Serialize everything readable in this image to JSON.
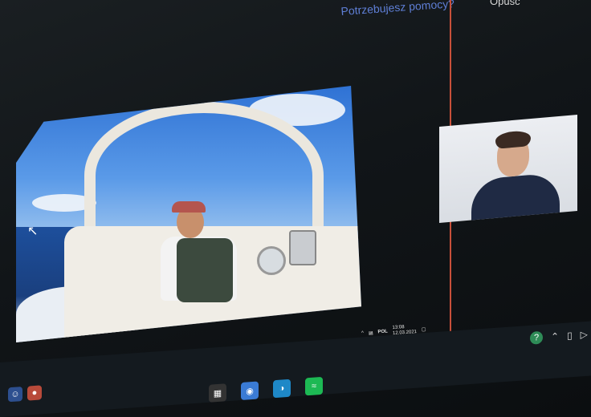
{
  "header": {
    "help_link": "Potrzebujesz pomocy?",
    "top_right_label": "Opuść"
  },
  "tray": {
    "language": "POL",
    "time": "13:08",
    "date": "12.03.2021"
  },
  "icons": {
    "cursor": "mouse-pointer-icon",
    "help": "help-icon",
    "chevron": "chevron-up-icon"
  },
  "colors": {
    "accent_border": "#c8503a",
    "help_link": "#5f7fd6",
    "spotify": "#1db954"
  }
}
